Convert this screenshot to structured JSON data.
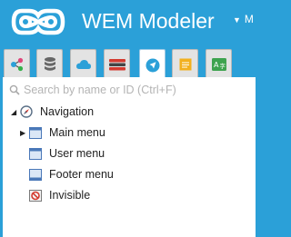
{
  "app": {
    "title": "WEM Modeler",
    "user_menu_label": "M"
  },
  "tabs": [
    {
      "name": "tab-flowchart",
      "icon": "share-nodes-icon",
      "active": false
    },
    {
      "name": "tab-database",
      "icon": "database-icon",
      "active": false
    },
    {
      "name": "tab-cloud",
      "icon": "cloud-icon",
      "active": false
    },
    {
      "name": "tab-templates",
      "icon": "stacked-bars-icon",
      "active": false
    },
    {
      "name": "tab-navigation",
      "icon": "compass-navigation-icon",
      "active": true
    },
    {
      "name": "tab-notes",
      "icon": "note-icon",
      "active": false
    },
    {
      "name": "tab-translations",
      "icon": "translate-icon",
      "active": false
    }
  ],
  "search": {
    "placeholder": "Search by name or ID (Ctrl+F)",
    "value": ""
  },
  "tree": {
    "root": {
      "label": "Navigation",
      "icon": "compass-icon",
      "expanded": true
    },
    "children": [
      {
        "label": "Main menu",
        "icon": "menu-window-icon",
        "expandable": true
      },
      {
        "label": "User menu",
        "icon": "menu-window-icon",
        "expandable": false
      },
      {
        "label": "Footer menu",
        "icon": "menu-window-icon",
        "expandable": false
      },
      {
        "label": "Invisible",
        "icon": "no-entry-icon",
        "expandable": false
      }
    ]
  },
  "colors": {
    "brand": "#2ba0d8",
    "tab_bg": "#e3e3e3",
    "panel_bg": "#ffffff"
  }
}
